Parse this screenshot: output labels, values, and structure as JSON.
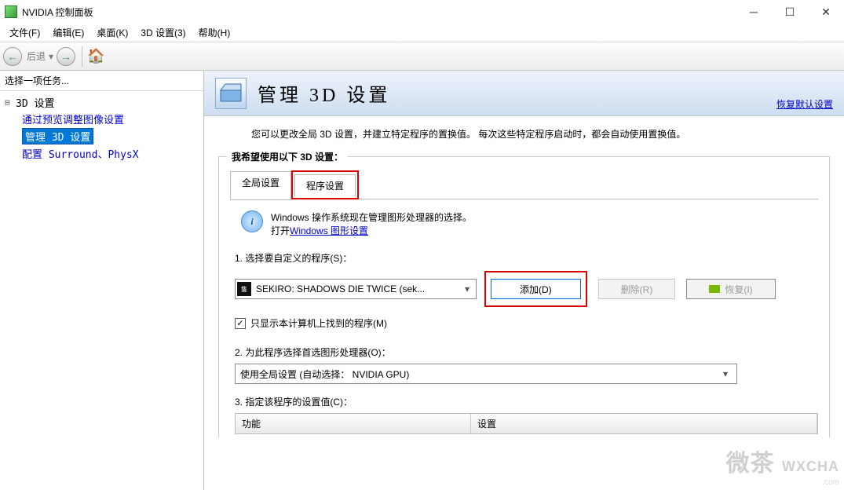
{
  "window": {
    "title": "NVIDIA 控制面板"
  },
  "menu": {
    "file": "文件(F)",
    "edit": "编辑(E)",
    "desktop": "桌面(K)",
    "settings3d": "3D 设置(3)",
    "help": "帮助(H)"
  },
  "toolbar": {
    "back_label": "后退"
  },
  "tree": {
    "header": "选择一项任务...",
    "root": "3D 设置",
    "items": [
      "通过预览调整图像设置",
      "管理 3D 设置",
      "配置 Surround、PhysX"
    ],
    "selected_index": 1
  },
  "page": {
    "title": "管理 3D 设置",
    "restore_defaults": "恢复默认设置",
    "description": "您可以更改全局 3D 设置，并建立特定程序的置换值。 每次这些特定程序启动时，都会自动使用置换值。",
    "group_title": "我希望使用以下 3D 设置：",
    "tabs": {
      "global": "全局设置",
      "program": "程序设置",
      "active": "program"
    },
    "info_line1": "Windows 操作系统现在管理图形处理器的选择。",
    "info_line2_prefix": "打开",
    "info_link": "Windows 图形设置",
    "step1_label": "1. 选择要自定义的程序(S)：",
    "program_select": {
      "text": "SEKIRO: SHADOWS DIE TWICE (sek... "
    },
    "add_button": "添加(D)",
    "remove_button": "删除(R)",
    "restore_button": "恢复(I)",
    "checkbox_label": "只显示本计算机上找到的程序(M)",
    "checkbox_checked": true,
    "step2_label": "2. 为此程序选择首选图形处理器(O)：",
    "gpu_select": "使用全局设置 (自动选择： NVIDIA GPU)",
    "step3_label": "3. 指定该程序的设置值(C)：",
    "col_feature": "功能",
    "col_setting": "设置"
  },
  "watermark": {
    "brand": "微茶",
    "url": "WXCHA",
    "sub": ".com"
  }
}
